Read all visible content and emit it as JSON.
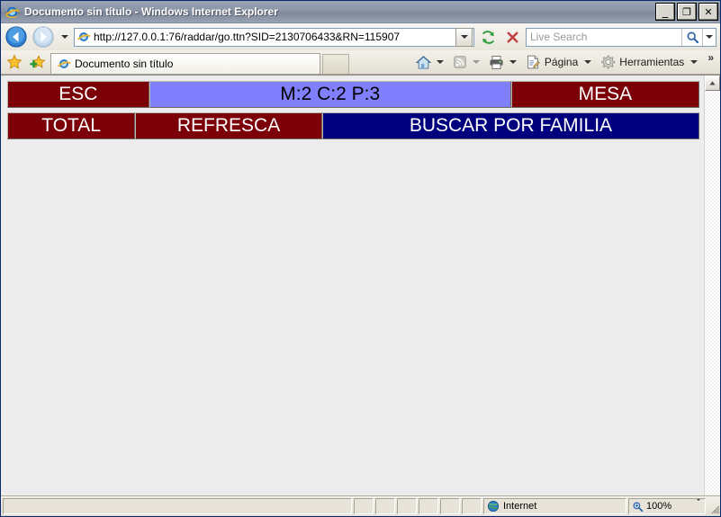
{
  "window": {
    "title": "Documento sin título - Windows Internet Explorer",
    "icon": "internet-explorer-icon",
    "minimize_label": "_",
    "maximize_label": "❐",
    "close_label": "✕"
  },
  "navigation": {
    "back_label": "Back",
    "forward_label": "Forward",
    "recent_pages_label": "Recent Pages",
    "address": "http://127.0.0.1:76/raddar/go.ttn?SID=2130706433&RN=115907",
    "refresh_label": "Refresh",
    "stop_label": "Stop"
  },
  "search": {
    "placeholder": "Live Search",
    "go_label": "Search",
    "provider_label": "Change Search Defaults"
  },
  "tabs": {
    "favorites_center_label": "Favorites Center",
    "add_favorites_label": "Add to Favorites",
    "items": [
      {
        "label": "Documento sin título",
        "icon": "internet-explorer-icon",
        "active": true
      }
    ],
    "new_tab_label": "New Tab"
  },
  "command_bar": {
    "home_label": "Home",
    "feeds_label": "Feeds",
    "print_label": "Print",
    "page_label": "Página",
    "tools_label": "Herramientas",
    "overflow_label": "»"
  },
  "page": {
    "rows": [
      [
        {
          "label": "ESC",
          "style": "maroon",
          "width_pct": 20.5
        },
        {
          "label": "M:2 C:2 P:3",
          "style": "peri",
          "width_pct": 52.3
        },
        {
          "label": "MESA",
          "style": "maroon",
          "width_pct": 27.2
        }
      ],
      [
        {
          "label": "TOTAL",
          "style": "maroon",
          "width_pct": 18.5
        },
        {
          "label": "REFRESCA",
          "style": "maroon",
          "width_pct": 27.0
        },
        {
          "label": "BUSCAR POR FAMILIA",
          "style": "navy",
          "width_pct": 54.5
        }
      ]
    ],
    "scroll_up_label": "▲"
  },
  "status_bar": {
    "message": "",
    "zone_label": "Internet",
    "zone_icon": "globe-icon",
    "zoom_label": "100%",
    "zoom_icon": "zoom-magnifier-icon",
    "zoom_dropdown_label": "▾"
  },
  "colors": {
    "maroon": "#7b0007",
    "navy": "#00007f",
    "periwinkle": "#8080ff",
    "page_background": "#ececec",
    "titlebar": "#8b95a6"
  }
}
